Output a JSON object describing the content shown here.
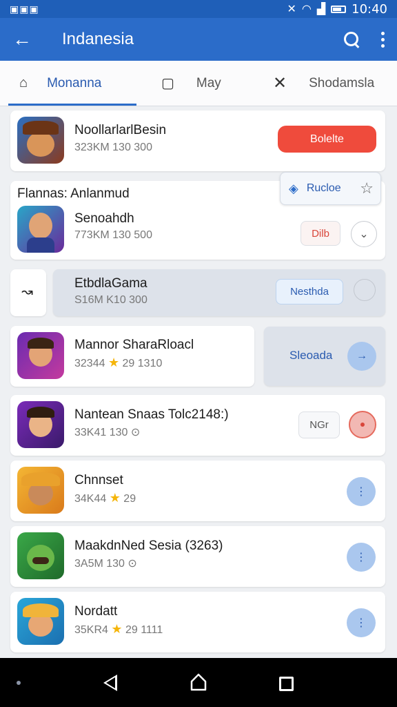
{
  "status_bar": {
    "left_icons": "▣▣▣",
    "time": "10:40"
  },
  "app_bar": {
    "title": "Indanesia"
  },
  "tabs": [
    {
      "label": "Monanna",
      "icon": "home-icon",
      "active": true
    },
    {
      "label": "May",
      "icon": "calendar-icon",
      "active": false
    },
    {
      "label": "Shodamsla",
      "icon": "close-icon",
      "active": false
    }
  ],
  "section_header": "Flannas: Anlanmud",
  "floating_chip": {
    "label": "Rucloe"
  },
  "apps": [
    {
      "name": "NoollarlarlBesin",
      "meta": "323KM 130 300",
      "action": "Bolelte",
      "action_style": "red-button"
    },
    {
      "name": "Senoahdh",
      "meta": "773KM 130 500",
      "action": "Dilb",
      "action_style": "pill-circle"
    },
    {
      "name": "EtbdlaGama",
      "meta": "S16M K10 300",
      "action": "Nesthda",
      "action_style": "pill-circle"
    },
    {
      "name": "Mannor SharaRloacl",
      "meta": "32344 ★ 29 1310",
      "action": "Sleoada",
      "action_style": "blue-circle"
    },
    {
      "name": "Nantean Snaas Tolc2148:)",
      "meta": "33K41 130 ⊙",
      "action": "NGr",
      "action_style": "red-circle"
    },
    {
      "name": "Chnnset",
      "meta": "34K44 ★ 29",
      "action": "",
      "action_style": "blue-circle"
    },
    {
      "name": "MaakdnNed Sesia (3263)",
      "meta": "3A5M 130 ⊙",
      "action": "",
      "action_style": "blue-circle"
    },
    {
      "name": "Nordatt",
      "meta": "35KR4 ★ 29 1111",
      "action": "",
      "action_style": "blue-circle"
    }
  ],
  "colors": {
    "primary": "#2b6cc9",
    "status_bar": "#1f5fb8",
    "danger": "#ef4b3c",
    "chip_blue": "#aac7ee"
  }
}
